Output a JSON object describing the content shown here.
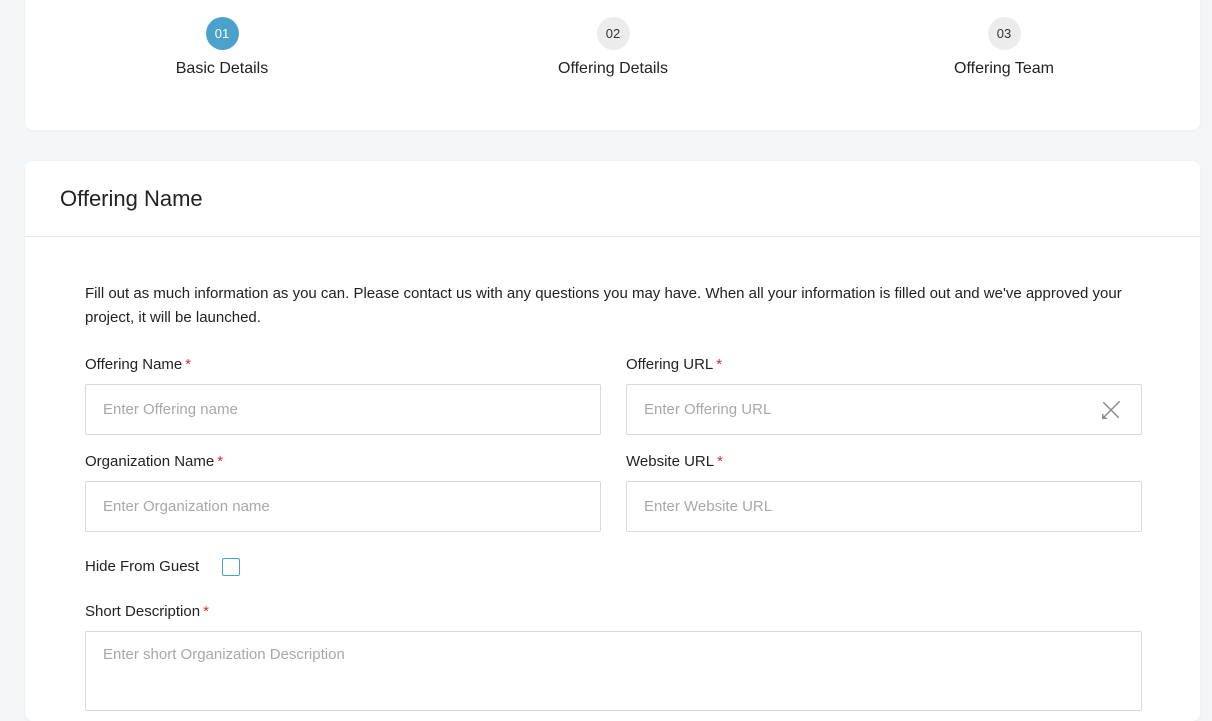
{
  "stepper": {
    "steps": [
      {
        "number": "01",
        "label": "Basic Details"
      },
      {
        "number": "02",
        "label": "Offering Details"
      },
      {
        "number": "03",
        "label": "Offering Team"
      }
    ]
  },
  "form": {
    "title": "Offering Name",
    "intro": "Fill out as much information as you can. Please contact us with any questions you may have. When all your information is filled out and we've approved your project, it will be launched.",
    "required_marker": "*",
    "offering_name": {
      "label": "Offering Name",
      "placeholder": "Enter Offering name",
      "value": ""
    },
    "offering_url": {
      "label": "Offering URL",
      "placeholder": "Enter Offering URL",
      "value": "",
      "icon": "link-off-icon"
    },
    "organization_name": {
      "label": "Organization Name",
      "placeholder": "Enter Organization name",
      "value": ""
    },
    "website_url": {
      "label": "Website URL",
      "placeholder": "Enter Website URL",
      "value": ""
    },
    "hide_from_guest": {
      "label": "Hide From Guest",
      "checked": false
    },
    "short_description": {
      "label": "Short Description",
      "placeholder": "Enter short Organization Description",
      "value": ""
    }
  },
  "colors": {
    "accent": "#4aa2cc",
    "required": "#d0302b",
    "placeholder": "#a8a8a8",
    "border": "#d9d9d9"
  }
}
